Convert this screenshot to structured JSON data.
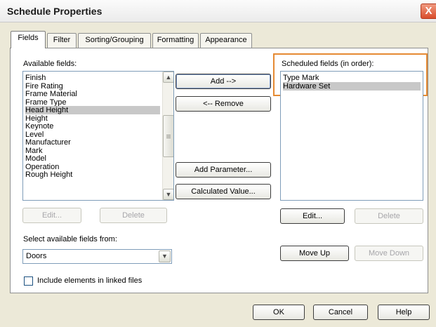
{
  "window": {
    "title": "Schedule Properties",
    "close_glyph": "X"
  },
  "tabs": [
    {
      "label": "Fields",
      "active": true
    },
    {
      "label": "Filter"
    },
    {
      "label": "Sorting/Grouping"
    },
    {
      "label": "Formatting"
    },
    {
      "label": "Appearance"
    }
  ],
  "available": {
    "label": "Available fields:",
    "items": [
      "Finish",
      "Fire Rating",
      "Frame Material",
      "Frame Type",
      "Head Height",
      "Height",
      "Keynote",
      "Level",
      "Manufacturer",
      "Mark",
      "Model",
      "Operation",
      "Rough Height"
    ],
    "selected": "Head Height",
    "edit_label": "Edit...",
    "delete_label": "Delete"
  },
  "middle": {
    "add_label": "Add -->",
    "remove_label": "<-- Remove",
    "add_parameter_label": "Add Parameter...",
    "calculated_value_label": "Calculated Value..."
  },
  "scheduled": {
    "label": "Scheduled fields (in order):",
    "items": [
      "Type Mark",
      "Hardware Set"
    ],
    "selected": "Hardware Set",
    "edit_label": "Edit...",
    "delete_label": "Delete",
    "move_up_label": "Move Up",
    "move_down_label": "Move Down"
  },
  "source": {
    "label": "Select available fields from:",
    "value": "Doors"
  },
  "linked": {
    "label": "Include elements in linked files",
    "checked": false
  },
  "footer": {
    "ok_label": "OK",
    "cancel_label": "Cancel",
    "help_label": "Help"
  },
  "colors": {
    "selection": "#c8c8c8",
    "highlight_border": "#e58a33",
    "close_button": "#d94d2c"
  }
}
